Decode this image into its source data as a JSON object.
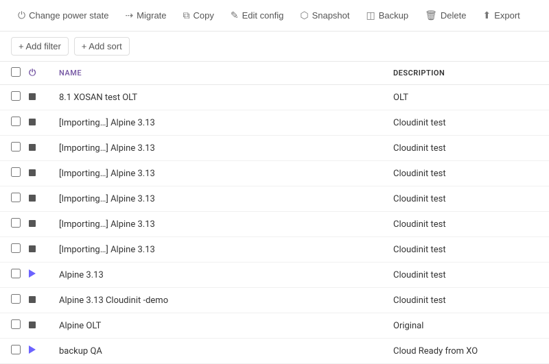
{
  "toolbar": {
    "buttons": [
      {
        "id": "change-power-state",
        "label": "Change power state",
        "icon": "⏻"
      },
      {
        "id": "migrate",
        "label": "Migrate",
        "icon": "↗"
      },
      {
        "id": "copy",
        "label": "Copy",
        "icon": "⧉"
      },
      {
        "id": "edit-config",
        "label": "Edit config",
        "icon": "✎"
      },
      {
        "id": "snapshot",
        "label": "Snapshot",
        "icon": "📷"
      },
      {
        "id": "backup",
        "label": "Backup",
        "icon": "💾"
      },
      {
        "id": "delete",
        "label": "Delete",
        "icon": "🗑"
      },
      {
        "id": "export",
        "label": "Export",
        "icon": "⬆"
      }
    ]
  },
  "filterbar": {
    "add_filter_label": "+ Add filter",
    "add_sort_label": "+ Add sort"
  },
  "table": {
    "columns": [
      {
        "id": "name",
        "label": "Name"
      },
      {
        "id": "description",
        "label": "Description"
      }
    ],
    "rows": [
      {
        "name": "8.1 XOSAN test OLT",
        "description": "OLT",
        "status": "square"
      },
      {
        "name": "[Importing…] Alpine 3.13",
        "description": "Cloudinit test",
        "status": "square"
      },
      {
        "name": "[Importing…] Alpine 3.13",
        "description": "Cloudinit test",
        "status": "square"
      },
      {
        "name": "[Importing…] Alpine 3.13",
        "description": "Cloudinit test",
        "status": "square"
      },
      {
        "name": "[Importing…] Alpine 3.13",
        "description": "Cloudinit test",
        "status": "square"
      },
      {
        "name": "[Importing…] Alpine 3.13",
        "description": "Cloudinit test",
        "status": "square"
      },
      {
        "name": "[Importing…] Alpine 3.13",
        "description": "Cloudinit test",
        "status": "square"
      },
      {
        "name": "Alpine 3.13",
        "description": "Cloudinit test",
        "status": "triangle"
      },
      {
        "name": "Alpine 3.13 Cloudinit -demo",
        "description": "Cloudinit test",
        "status": "square"
      },
      {
        "name": "Alpine OLT",
        "description": "Original",
        "status": "square"
      },
      {
        "name": "backup QA",
        "description": "Cloud Ready from XO",
        "status": "triangle"
      }
    ]
  }
}
